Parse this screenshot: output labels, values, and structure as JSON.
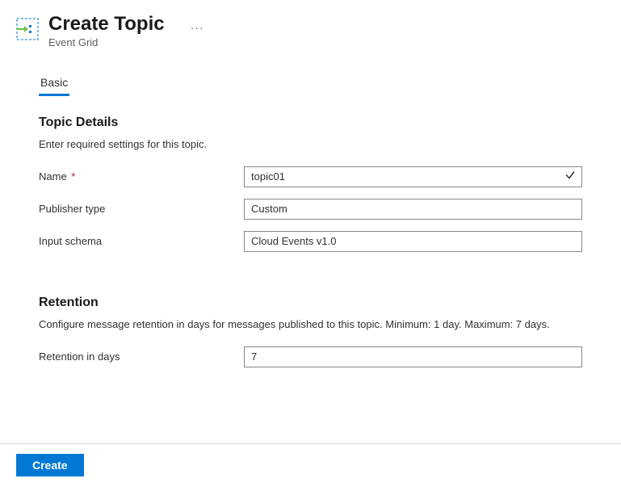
{
  "header": {
    "title": "Create Topic",
    "subtitle": "Event Grid"
  },
  "tabs": [
    {
      "label": "Basic"
    }
  ],
  "sections": {
    "topicDetails": {
      "title": "Topic Details",
      "description": "Enter required settings for this topic.",
      "fields": {
        "name": {
          "label": "Name",
          "value": "topic01",
          "required": true
        },
        "publisherType": {
          "label": "Publisher type",
          "value": "Custom"
        },
        "inputSchema": {
          "label": "Input schema",
          "value": "Cloud Events v1.0"
        }
      }
    },
    "retention": {
      "title": "Retention",
      "description": "Configure message retention in days for messages published to this topic. Minimum: 1 day. Maximum: 7 days.",
      "fields": {
        "retentionInDays": {
          "label": "Retention in days",
          "value": "7"
        }
      }
    }
  },
  "footer": {
    "createLabel": "Create"
  }
}
